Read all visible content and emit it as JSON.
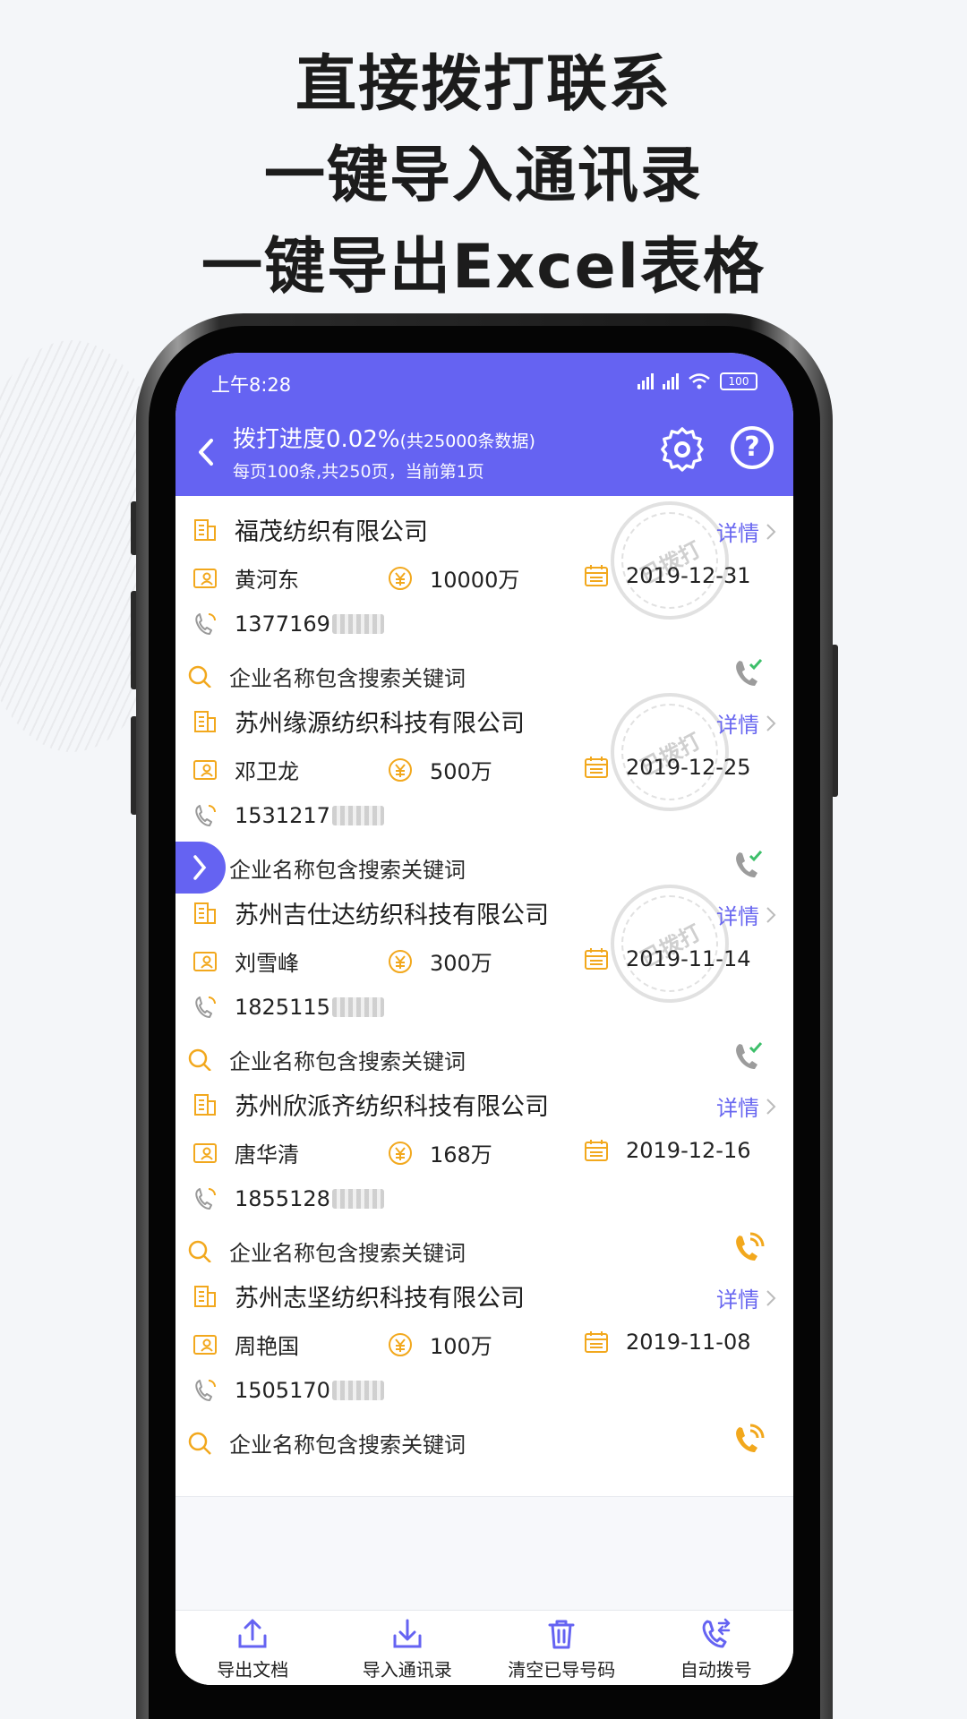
{
  "headline": {
    "line1": "直接拨打联系",
    "line2": "一键导入通讯录",
    "line3": "一键导出Excel表格"
  },
  "status_bar": {
    "time": "上午8:28",
    "battery": "100"
  },
  "nav": {
    "title": "拨打进度0.02%",
    "title_suffix": "(共25000条数据)",
    "subtitle": "每页100条,共250页，当前第1页"
  },
  "colors": {
    "primary": "#6563f2",
    "accent": "#f2a81d",
    "called_green": "#3dbf6a"
  },
  "list": {
    "detail_label": "详情",
    "stamp_text": "已拨打",
    "items": [
      {
        "company": "福茂纺织有限公司",
        "person": "黄河东",
        "capital": "10000万",
        "date": "2019-12-31",
        "phone": "1377169",
        "keyword": "企业名称包含搜索关键词",
        "status": "called"
      },
      {
        "company": "苏州缘源纺织科技有限公司",
        "person": "邓卫龙",
        "capital": "500万",
        "date": "2019-12-25",
        "phone": "1531217",
        "keyword": "企业名称包含搜索关键词",
        "status": "called"
      },
      {
        "company": "苏州吉仕达纺织科技有限公司",
        "person": "刘雪峰",
        "capital": "300万",
        "date": "2019-11-14",
        "phone": "1825115",
        "keyword": "企业名称包含搜索关键词",
        "status": "called"
      },
      {
        "company": "苏州欣派齐纺织科技有限公司",
        "person": "唐华清",
        "capital": "168万",
        "date": "2019-12-16",
        "phone": "1855128",
        "keyword": "企业名称包含搜索关键词",
        "status": "pending"
      },
      {
        "company": "苏州志坚纺织科技有限公司",
        "person": "周艳国",
        "capital": "100万",
        "date": "2019-11-08",
        "phone": "1505170",
        "keyword": "企业名称包含搜索关键词",
        "status": "pending"
      }
    ]
  },
  "bottom_bar": {
    "export": "导出文档",
    "import": "导入通讯录",
    "clear": "清空已导号码",
    "auto_dial": "自动拨号"
  }
}
